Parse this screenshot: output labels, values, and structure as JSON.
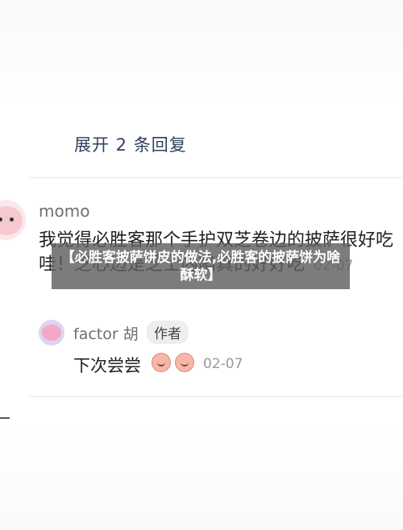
{
  "thread": {
    "expand_replies": "展开 2 条回复"
  },
  "comment": {
    "username": "momo",
    "text": "我觉得必胜客那个手护双芝卷边的披萨很好吃哇！芝心边是芝士内陷真的好好吃",
    "timestamp": "02-07"
  },
  "reply": {
    "username": "factor 胡",
    "author_badge": "作者",
    "text": "下次尝尝",
    "timestamp": "02-07",
    "emoji_icons": [
      "laughing-emoji-icon",
      "laughing-emoji-icon"
    ]
  },
  "banner": {
    "title": "【必胜客披萨饼皮的做法,必胜客的披萨饼为啥酥软】"
  },
  "colors": {
    "accent": "#2f3f5e",
    "banner_bg": "#5f5f5f",
    "muted_text": "#9a9a9a"
  }
}
